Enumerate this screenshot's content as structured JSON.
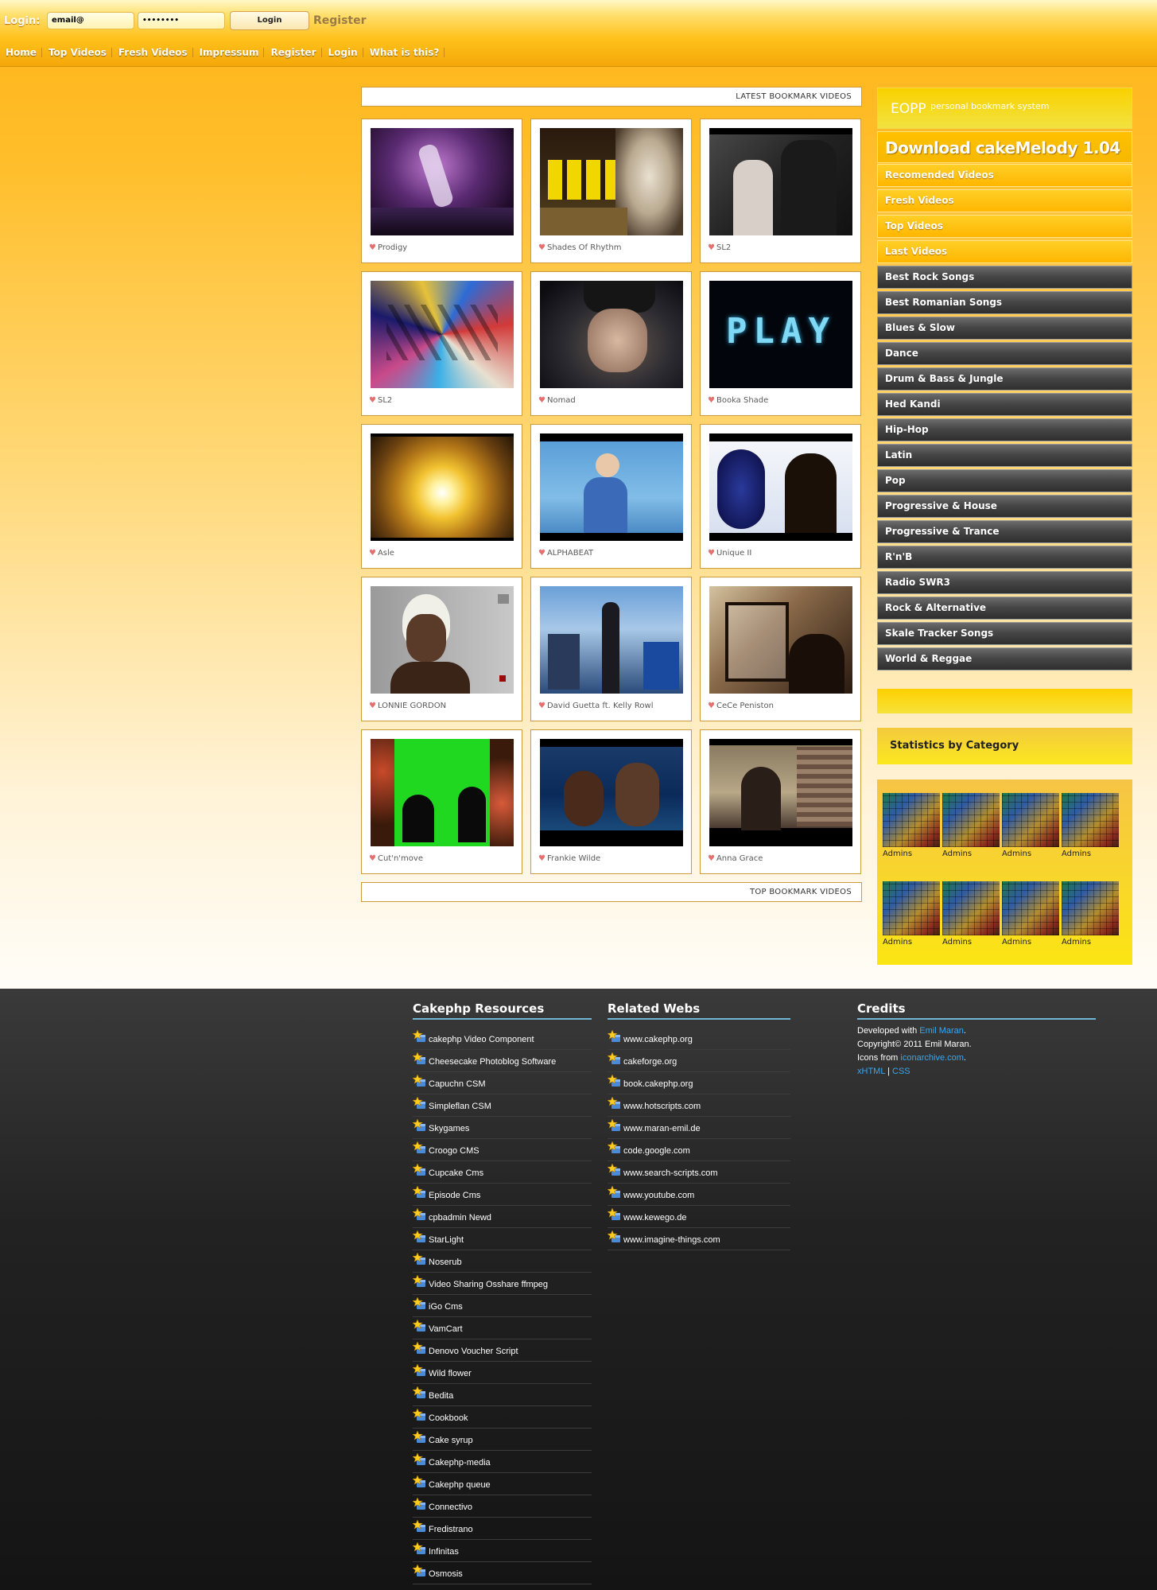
{
  "login": {
    "label": "Login:",
    "email_value": "email@",
    "password_value": "••••••••",
    "button_label": "Login",
    "register_label": "Register"
  },
  "nav": [
    "Home",
    "Top Videos",
    "Fresh Videos",
    "Impressum",
    "Register",
    "Login",
    "What is this?"
  ],
  "sections": {
    "latest": "LATEST BOOKMARK VIDEOS",
    "top": "TOP BOOKMARK VIDEOS"
  },
  "videos": [
    {
      "title": "Prodigy",
      "scene": "purple-stage"
    },
    {
      "title": "Shades Of Rhythm",
      "scene": "dancers-mask"
    },
    {
      "title": "SL2",
      "scene": "street-night"
    },
    {
      "title": "SL2",
      "scene": "graffiti"
    },
    {
      "title": "Nomad",
      "scene": "singer-dark"
    },
    {
      "title": "Booka Shade",
      "scene": "play-led"
    },
    {
      "title": "Asle",
      "scene": "golden-tunnel"
    },
    {
      "title": "ALPHABEAT",
      "scene": "blue-singer"
    },
    {
      "title": "Unique II",
      "scene": "blue-portrait"
    },
    {
      "title": "LONNIE GORDON",
      "scene": "grey-portrait"
    },
    {
      "title": "David Guetta ft. Kelly Rowl",
      "scene": "street-woman"
    },
    {
      "title": "CeCe Peniston",
      "scene": "brown-crowd"
    },
    {
      "title": "Cut'n'move",
      "scene": "green-screen"
    },
    {
      "title": "Frankie Wilde",
      "scene": "sea-couple"
    },
    {
      "title": "Anna Grace",
      "scene": "city-woman"
    }
  ],
  "play_text": "PLAY",
  "sidebar": {
    "eopp_title": "EOPP",
    "eopp_subtitle": "personal bookmark system",
    "download": "Download cakeMelody 1.04",
    "gold_items": [
      "Recomended Videos",
      "Fresh Videos",
      "Top Videos",
      "Last Videos"
    ],
    "categories": [
      "Best Rock Songs",
      "Best Romanian Songs",
      "Blues & Slow",
      "Dance",
      "Drum & Bass & Jungle",
      "Hed Kandi",
      "Hip-Hop",
      "Latin",
      "Pop",
      "Progressive & House",
      "Progressive & Trance",
      "R'n'B",
      "Radio SWR3",
      "Rock & Alternative",
      "Skale Tracker Songs",
      "World & Reggae"
    ],
    "stats_title": "Statistics by Category",
    "stats": [
      "Admins",
      "Admins",
      "Admins",
      "Admins",
      "Admins",
      "Admins",
      "Admins",
      "Admins"
    ]
  },
  "footer": {
    "resources_title": "Cakephp Resources",
    "resources": [
      "cakephp Video Component",
      "Cheesecake Photoblog Software",
      "Capuchn CSM",
      "Simpleflan CSM",
      "Skygames",
      "Croogo CMS",
      "Cupcake Cms",
      "Episode Cms",
      "cpbadmin Newd",
      "StarLight",
      "Noserub",
      "Video Sharing Osshare ffmpeg",
      "iGo Cms",
      "VamCart",
      "Denovo Voucher Script",
      "Wild flower",
      "Bedita",
      "Cookbook",
      "Cake syrup",
      "Cakephp-media",
      "Cakephp queue",
      "Connectivo",
      "Fredistrano",
      "Infinitas",
      "Osmosis"
    ],
    "related_title": "Related Webs",
    "related": [
      "www.cakephp.org",
      "cakeforge.org",
      "book.cakephp.org",
      "www.hotscripts.com",
      "www.maran-emil.de",
      "code.google.com",
      "www.search-scripts.com",
      "www.youtube.com",
      "www.kewego.de",
      "www.imagine-things.com"
    ],
    "credits_title": "Credits",
    "credits": {
      "developed_prefix": "Developed with",
      "developed_link": "Emil Maran",
      "developed_suffix": ".",
      "copyright": "Copyright© 2011 Emil Maran.",
      "icons_prefix": "Icons from",
      "icons_link": "iconarchive.com",
      "icons_suffix": ".",
      "xhtml": "xHTML",
      "sep": "|",
      "css": "CSS"
    }
  },
  "colors": {
    "accent": "#ffb418",
    "link_blue": "#34a8f2",
    "footer_bg": "#1b1b1b"
  }
}
